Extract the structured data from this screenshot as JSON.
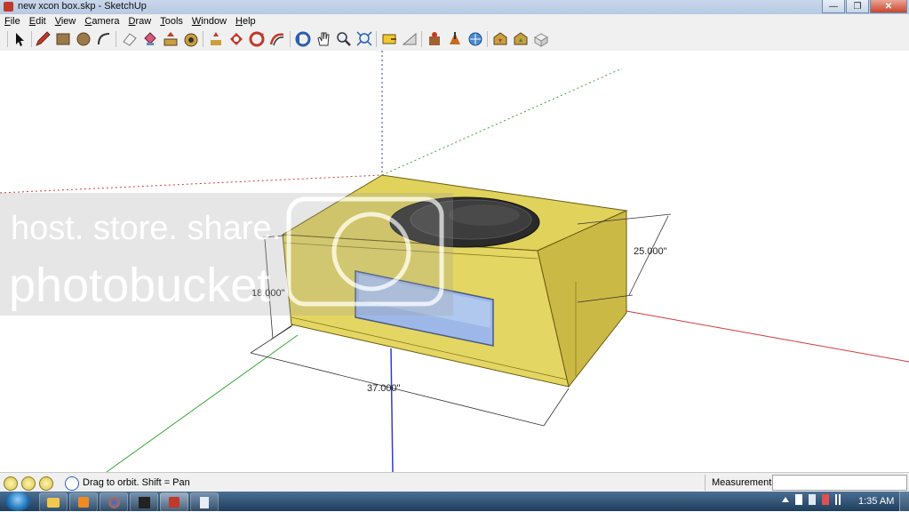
{
  "window": {
    "title": "new xcon box.skp - SketchUp"
  },
  "menu": {
    "items": [
      {
        "underline": "F",
        "rest": "ile"
      },
      {
        "underline": "E",
        "rest": "dit"
      },
      {
        "underline": "V",
        "rest": "iew"
      },
      {
        "underline": "C",
        "rest": "amera"
      },
      {
        "underline": "D",
        "rest": "raw"
      },
      {
        "underline": "T",
        "rest": "ools"
      },
      {
        "underline": "W",
        "rest": "indow"
      },
      {
        "underline": "H",
        "rest": "elp"
      }
    ]
  },
  "toolbar": {
    "tools": [
      "select-icon",
      "pencil-icon",
      "rectangle-icon",
      "circle-icon",
      "arc-icon",
      "eraser-icon",
      "paint-bucket-icon",
      "push-pull-icon",
      "follow-me-icon",
      "move-icon",
      "rotate-icon",
      "scale-icon",
      "offset-icon",
      "orbit-icon",
      "pan-icon",
      "zoom-icon",
      "zoom-extents-icon",
      "tape-measure-icon",
      "protractor-icon",
      "dimension-icon",
      "text-icon",
      "axes-icon",
      "get-models-icon",
      "share-model-icon",
      "components-icon"
    ]
  },
  "model": {
    "dimensions": {
      "depth": "25.000\"",
      "height": "18.000\"",
      "width": "37.000\""
    }
  },
  "watermark": {
    "line1": "host. store. share.",
    "line2": "photobucket"
  },
  "status": {
    "hint": "Drag to orbit.  Shift = Pan",
    "measurements_label": "Measurements",
    "measurements_value": ""
  },
  "taskbar": {
    "clock": "1:35 AM"
  },
  "colors": {
    "box_face": "#e0d25b",
    "box_side": "#cbb946",
    "red_axis": "#d03a3a",
    "green_axis": "#3aa83a",
    "blue_axis": "#2c3fd0"
  }
}
